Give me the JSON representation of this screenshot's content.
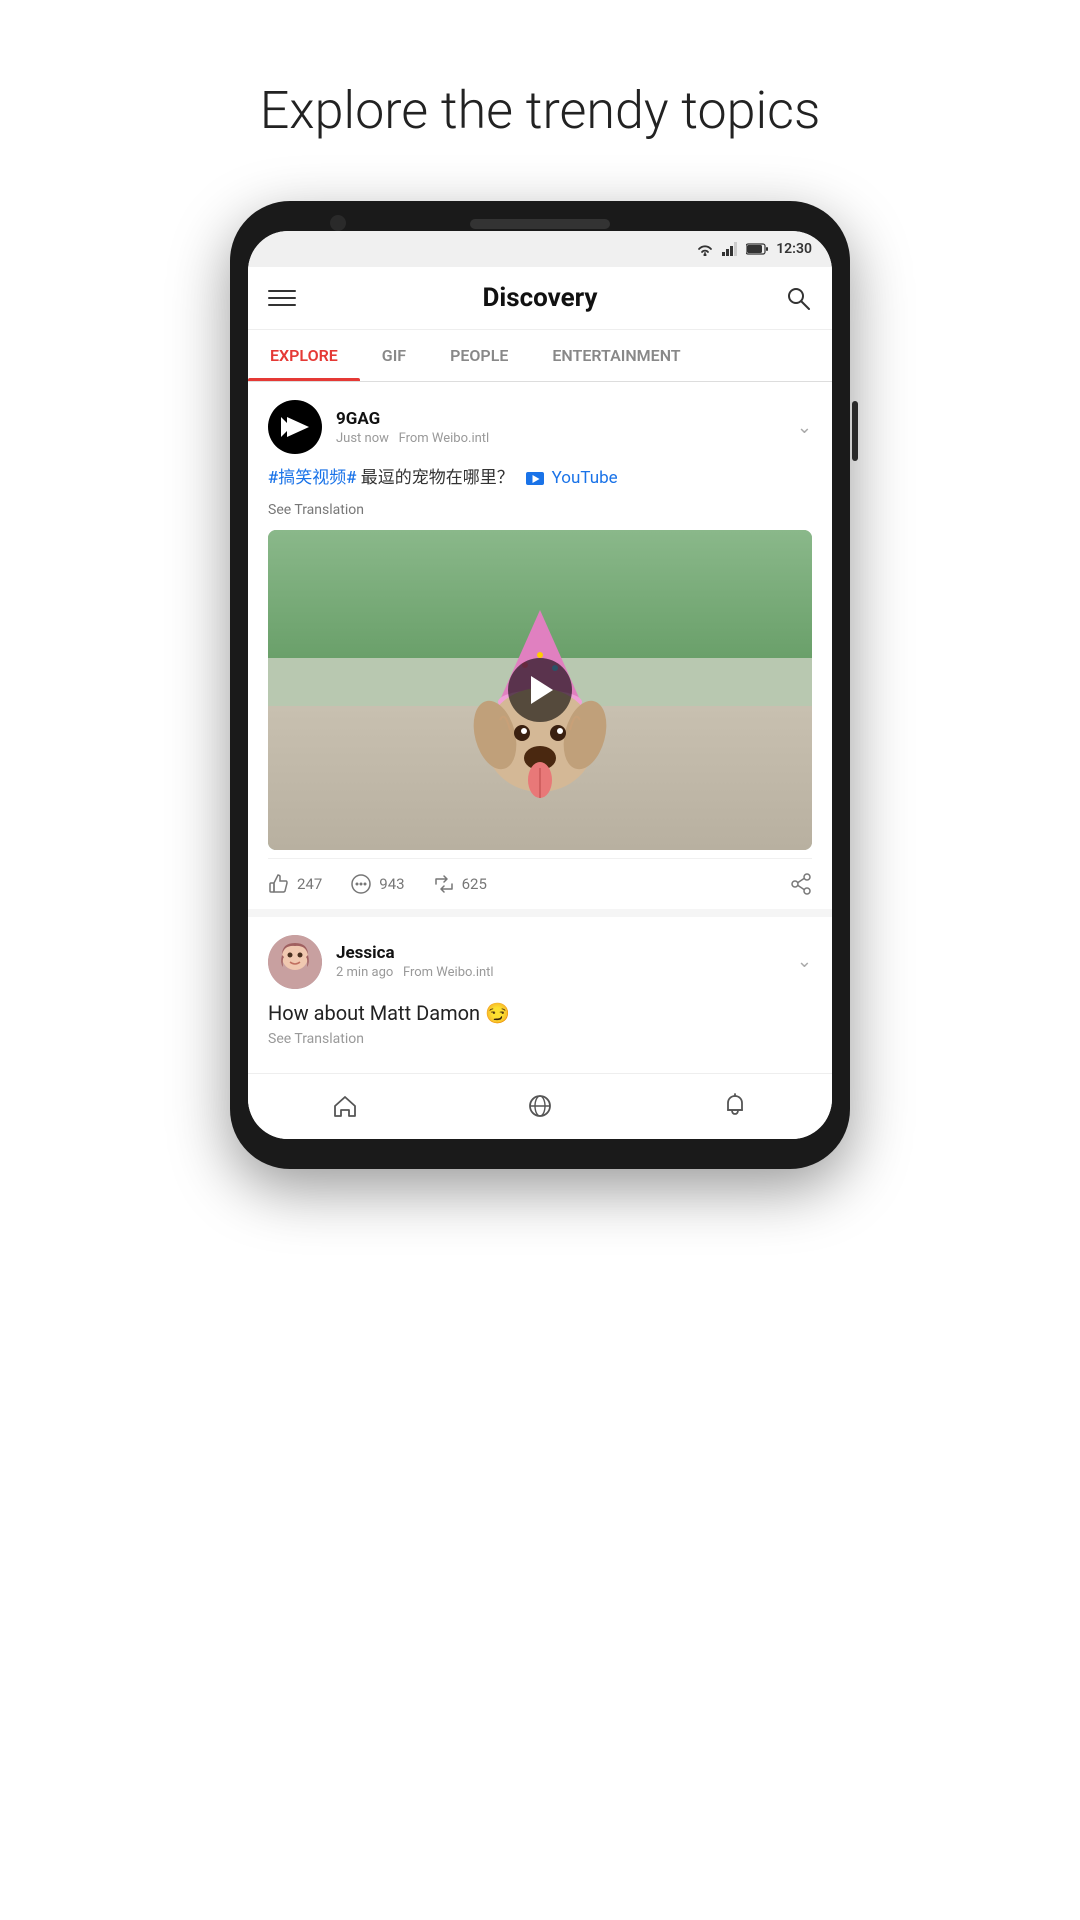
{
  "page": {
    "title": "Explore the trendy topics"
  },
  "statusBar": {
    "time": "12:30"
  },
  "header": {
    "title": "Discovery",
    "menuLabel": "Menu",
    "searchLabel": "Search"
  },
  "tabs": [
    {
      "id": "explore",
      "label": "EXPLORE",
      "active": true
    },
    {
      "id": "gif",
      "label": "GIF",
      "active": false
    },
    {
      "id": "people",
      "label": "PEOPLE",
      "active": false
    },
    {
      "id": "entertainment",
      "label": "ENTERTAINMENT",
      "active": false
    }
  ],
  "posts": [
    {
      "id": "post1",
      "username": "9GAG",
      "timeAgo": "Just now",
      "source": "From Weibo.intl",
      "hashtag": "#搞笑视频#",
      "contentText": "最逗的宠物在哪里？",
      "youtubeLabel": "YouTube",
      "seeTranslation": "See Translation",
      "likes": "247",
      "comments": "943",
      "shares": "625"
    },
    {
      "id": "post2",
      "username": "Jessica",
      "timeAgo": "2 min ago",
      "source": "From Weibo.intl",
      "contentText": "How about Matt Damon 😏",
      "seeTranslation": "See Translation"
    }
  ],
  "bottomNav": {
    "items": [
      {
        "id": "home",
        "label": "Home"
      },
      {
        "id": "discover",
        "label": "Discover"
      },
      {
        "id": "notifications",
        "label": "Notifications"
      }
    ]
  },
  "colors": {
    "accent": "#e53935",
    "blue": "#1a73e8",
    "tabActive": "#e53935",
    "tabInactive": "#888"
  }
}
